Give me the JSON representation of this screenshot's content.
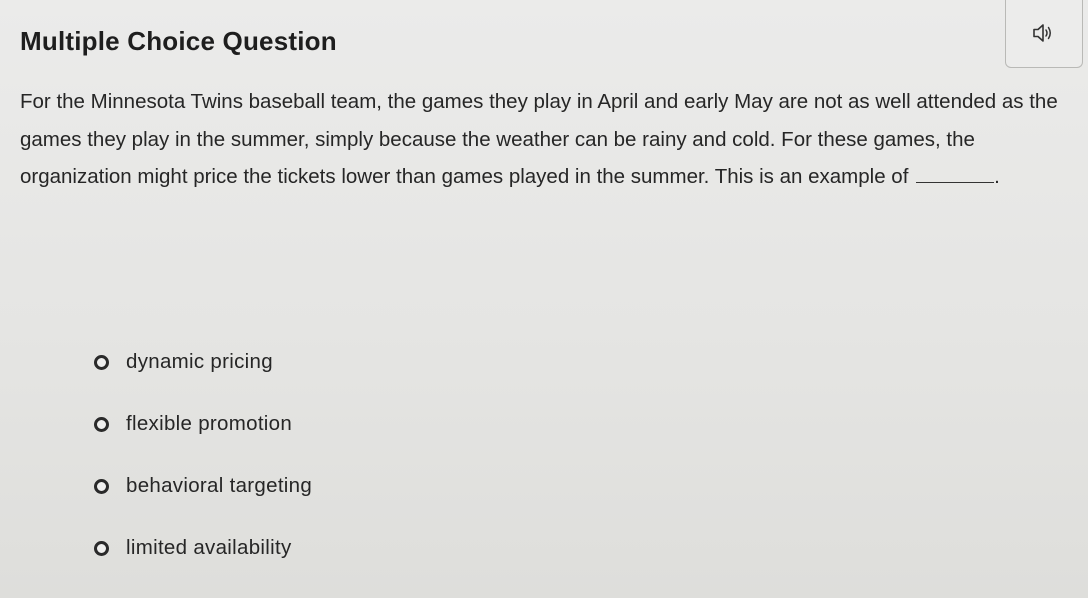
{
  "header": {
    "title": "Multiple Choice Question",
    "audio_icon": "speaker-icon"
  },
  "question": {
    "text": "For the Minnesota Twins baseball team, the games they play in April and early May are not as well attended as the games they play in the summer, simply because the weather can be rainy and cold. For these games, the organization might price the tickets lower than games played in the summer. This is an example of",
    "suffix": "."
  },
  "options": [
    {
      "label": "dynamic pricing",
      "selected": false
    },
    {
      "label": "flexible promotion",
      "selected": false
    },
    {
      "label": "behavioral targeting",
      "selected": false
    },
    {
      "label": "limited availability",
      "selected": false
    }
  ]
}
